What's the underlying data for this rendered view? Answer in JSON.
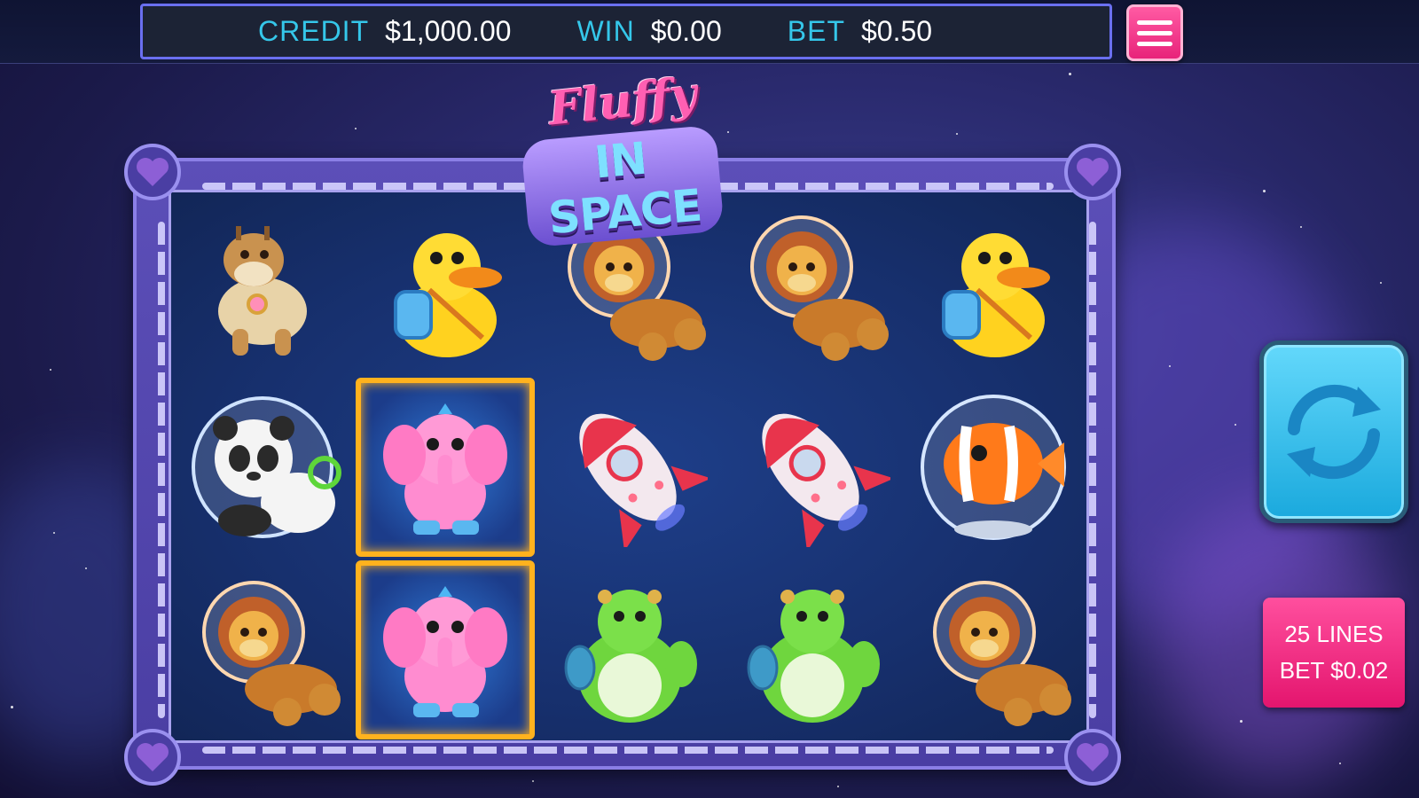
{
  "hud": {
    "credit_label": "CREDIT",
    "credit_value": "$1,000.00",
    "win_label": "WIN",
    "win_value": "$0.00",
    "bet_label": "BET",
    "bet_value": "$0.50"
  },
  "logo": {
    "line1": "Fluffy",
    "line2": "IN SPACE"
  },
  "reels": [
    [
      "giraffe",
      "panda",
      "lion"
    ],
    [
      "duck",
      "elephant",
      "elephant"
    ],
    [
      "lion",
      "rocket",
      "turtle"
    ],
    [
      "lion",
      "rocket",
      "turtle"
    ],
    [
      "duck",
      "clownfish",
      "lion"
    ]
  ],
  "winning_cells": [
    [
      1,
      1
    ],
    [
      1,
      2
    ]
  ],
  "lines_button": {
    "line1": "25 LINES",
    "line2": "BET $0.02"
  },
  "icons": {
    "menu": "hamburger-menu-icon",
    "spin": "spin-arrows-icon"
  },
  "colors": {
    "accent_cyan": "#35c7ea",
    "menu_pink": "#e8237a",
    "win_highlight": "#ffb21e",
    "spin_blue": "#1aa9dd"
  }
}
